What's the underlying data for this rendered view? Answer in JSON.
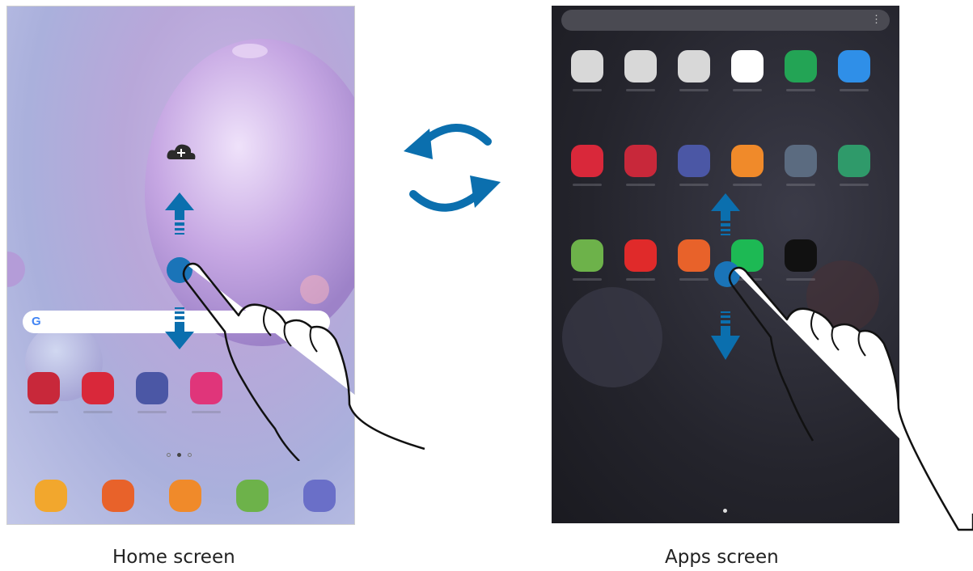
{
  "captions": {
    "home": "Home screen",
    "apps": "Apps screen"
  },
  "home": {
    "search_letter": "G",
    "row_apps": [
      {
        "icon": "gallery-icon",
        "color": "#c8283a"
      },
      {
        "icon": "camera-icon",
        "color": "#d9283a"
      },
      {
        "icon": "clock-icon",
        "color": "#4b57a5"
      },
      {
        "icon": "galaxy-store-icon",
        "color": "#e0357a"
      }
    ],
    "dock_apps": [
      {
        "icon": "my-files-icon",
        "color": "#f2a72d"
      },
      {
        "icon": "samsung-notes-icon",
        "color": "#e8622a"
      },
      {
        "icon": "contacts-icon",
        "color": "#f08a2a"
      },
      {
        "icon": "calculator-icon",
        "color": "#6db24a"
      },
      {
        "icon": "internet-icon",
        "color": "#6a6fc8"
      }
    ]
  },
  "apps": {
    "menu_glyph": "⋮",
    "rows": [
      [
        {
          "icon": "samsung-folder-icon",
          "color": "#d8d8d8"
        },
        {
          "icon": "google-folder-icon",
          "color": "#d8d8d8"
        },
        {
          "icon": "microsoft-folder-icon",
          "color": "#d8d8d8"
        },
        {
          "icon": "play-store-icon",
          "color": "#ffffff"
        },
        {
          "icon": "phone-icon",
          "color": "#23a455"
        },
        {
          "icon": "messages-icon",
          "color": "#2f8fe8"
        }
      ],
      [
        {
          "icon": "camera-icon",
          "color": "#d9283a"
        },
        {
          "icon": "gallery-icon",
          "color": "#c8283a"
        },
        {
          "icon": "clock-icon",
          "color": "#4b57a5"
        },
        {
          "icon": "contacts-icon",
          "color": "#f08a2a"
        },
        {
          "icon": "settings-icon",
          "color": "#5b6b80"
        },
        {
          "icon": "calendar-icon",
          "color": "#2f9a6a"
        }
      ],
      [
        {
          "icon": "calculator-icon",
          "color": "#6db24a"
        },
        {
          "icon": "yt-music-icon",
          "color": "#e02a2a"
        },
        {
          "icon": "samsung-notes-icon",
          "color": "#e8622a"
        },
        {
          "icon": "spotify-icon",
          "color": "#1db954"
        },
        {
          "icon": "netflix-icon",
          "color": "#111111"
        }
      ]
    ]
  },
  "colors": {
    "arrow": "#0b6fae",
    "touch": "#1a74b8"
  }
}
